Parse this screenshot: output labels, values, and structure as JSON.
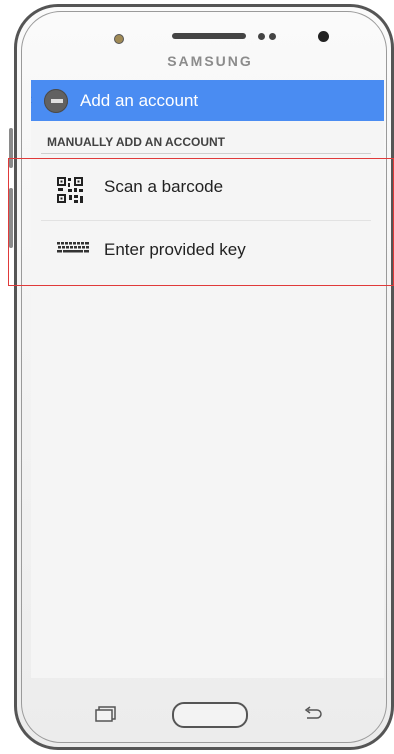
{
  "device": {
    "brand": "SAMSUNG"
  },
  "app_bar": {
    "title": "Add an account"
  },
  "section": {
    "header": "MANUALLY ADD AN ACCOUNT"
  },
  "options": [
    {
      "label": "Scan a barcode",
      "icon": "qr-code-icon"
    },
    {
      "label": "Enter provided key",
      "icon": "keyboard-icon"
    }
  ],
  "colors": {
    "app_bar": "#4a8cf2",
    "highlight": "#e03a3a",
    "screen_bg": "#f5f5f5"
  }
}
